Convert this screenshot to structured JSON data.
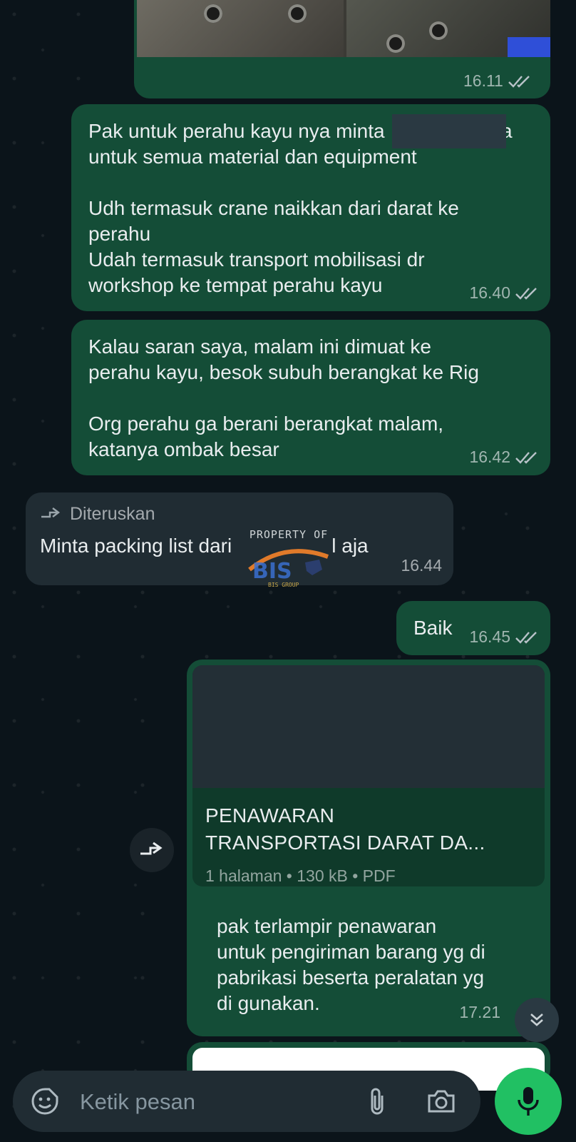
{
  "messages": [
    {
      "id": "m0",
      "type": "image",
      "direction": "out",
      "time": "16.11",
      "status": "read"
    },
    {
      "id": "m1",
      "direction": "out",
      "text": "Pak untuk perahu kayu nya minta                    ta\nuntuk semua material dan equipment\n\nUdh termasuk crane naikkan dari darat ke\nperahu\nUdah termasuk transport mobilisasi dr\nworkshop ke tempat perahu kayu",
      "time": "16.40",
      "status": "read"
    },
    {
      "id": "m2",
      "direction": "out",
      "text": "Kalau saran saya, malam ini dimuat ke\nperahu kayu, besok subuh berangkat ke Rig\n\nOrg perahu ga berani berangkat malam,\nkatanya ombak besar",
      "time": "16.42",
      "status": "read"
    },
    {
      "id": "m3",
      "direction": "in",
      "forwarded_label": "Diteruskan",
      "text": "Minta packing list dari                  l aja",
      "time": "16.44"
    },
    {
      "id": "m4",
      "direction": "out",
      "text": "Baik",
      "time": "16.45",
      "status": "read"
    },
    {
      "id": "m5",
      "direction": "out",
      "type": "document",
      "document": {
        "title": "PENAWARAN\nTRANSPORTASI DARAT DA...",
        "info": "1 halaman • 130 kB • PDF"
      },
      "caption": "pak terlampir penawaran\nuntuk pengiriman barang yg di\npabrikasi beserta peralatan yg\ndi gunakan.",
      "time": "17.21"
    }
  ],
  "watermark": {
    "text": "PROPERTY OF",
    "logo_text": "BIS GROUP"
  },
  "composer": {
    "placeholder": "Ketik pesan"
  },
  "icons": {
    "read": "double-check-icon",
    "forward": "forward-icon",
    "scroll_down": "chevron-double-down-icon",
    "emoji": "emoji-sticker-icon",
    "attach": "paperclip-icon",
    "camera": "camera-icon",
    "mic": "microphone-icon"
  },
  "colors": {
    "background": "#0b141a",
    "outgoing": "#144d37",
    "incoming": "#202c33",
    "accent": "#21c063",
    "read_tick": "#8ea39a"
  }
}
